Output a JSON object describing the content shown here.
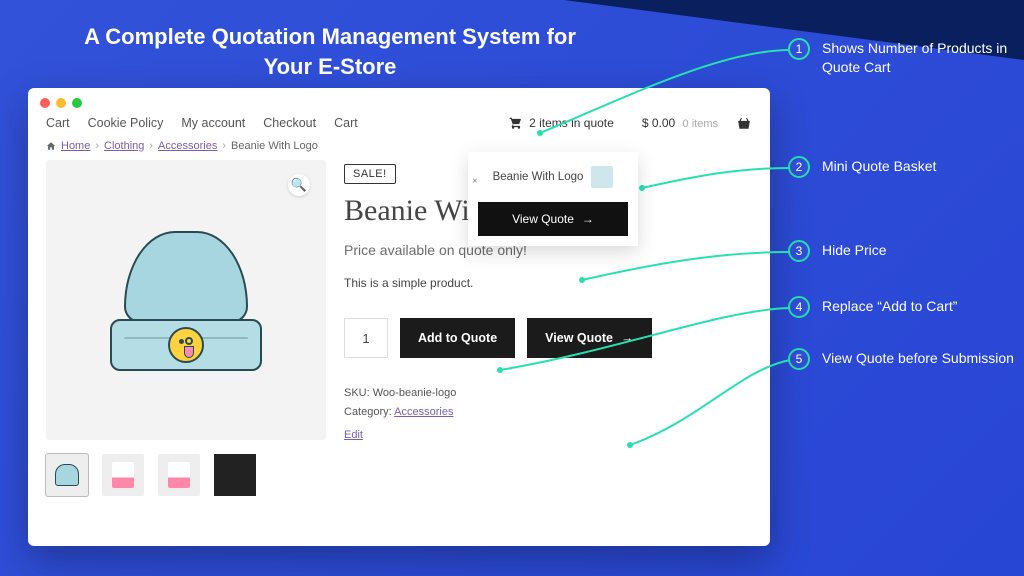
{
  "headline": "A Complete Quotation Management System for Your E-Store",
  "nav": {
    "items": [
      "Cart",
      "Cookie Policy",
      "My account",
      "Checkout",
      "Cart"
    ]
  },
  "quote_cart": {
    "label": "2 items in quote"
  },
  "price_widget": {
    "amount": "$ 0.00",
    "items": "0 items"
  },
  "mini_quote": {
    "item_name": "Beanie With Logo",
    "button": "View Quote"
  },
  "breadcrumb": {
    "home": "Home",
    "l1": "Clothing",
    "l2": "Accessories",
    "current": "Beanie With Logo"
  },
  "product": {
    "sale_badge": "SALE!",
    "title": "Beanie With Logo",
    "price_text": "Price available on quote only!",
    "desc": "This is a simple product.",
    "qty": "1",
    "add_to_quote": "Add to Quote",
    "view_quote": "View Quote",
    "sku_label": "SKU:",
    "sku": "Woo-beanie-logo",
    "cat_label": "Category:",
    "cat": "Accessories",
    "edit": "Edit"
  },
  "annotations": {
    "a1": "Shows Number of Products in Quote Cart",
    "a2": "Mini Quote Basket",
    "a3": "Hide Price",
    "a4": "Replace “Add to Cart”",
    "a5": "View Quote before Submission"
  }
}
